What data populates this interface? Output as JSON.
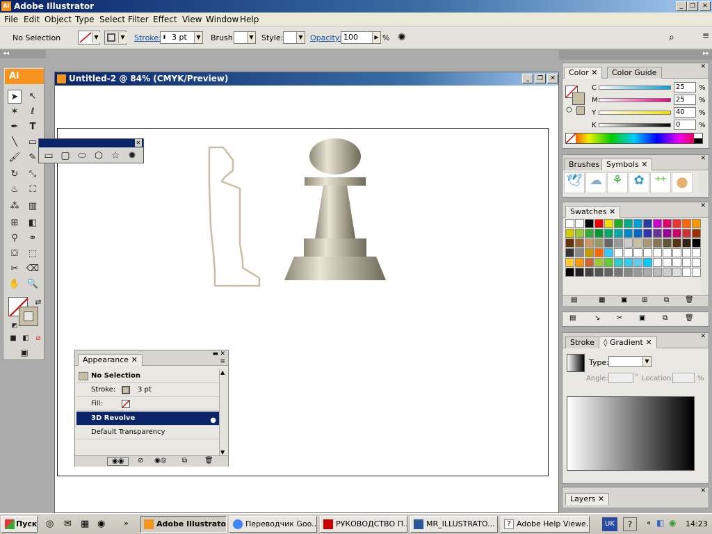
{
  "app": {
    "title": "Adobe Illustrator"
  },
  "menu": [
    "File",
    "Edit",
    "Object",
    "Type",
    "Select",
    "Filter",
    "Effect",
    "View",
    "Window",
    "Help"
  ],
  "control": {
    "selection": "No Selection",
    "stroke_label": "Stroke:",
    "stroke_value": "3 pt",
    "brush_label": "Brush:",
    "style_label": "Style:",
    "opacity_label": "Opacity:",
    "opacity_value": "100",
    "percent": "%"
  },
  "document": {
    "title": "Untitled-2 @ 84% (CMYK/Preview)"
  },
  "tools_logo": "Ai",
  "appearance": {
    "tab": "Appearance",
    "header": "No Selection",
    "stroke_label": "Stroke:",
    "stroke_value": "3 pt",
    "fill_label": "Fill:",
    "effect": "3D Revolve",
    "transparency": "Default Transparency"
  },
  "color_panel": {
    "tabs": [
      "Color",
      "Color Guide"
    ],
    "channels": [
      {
        "name": "C",
        "value": "25"
      },
      {
        "name": "M",
        "value": "25"
      },
      {
        "name": "Y",
        "value": "40"
      },
      {
        "name": "K",
        "value": "0"
      }
    ],
    "pct": "%"
  },
  "brushes_panel": {
    "tabs": [
      "Brushes",
      "Symbols"
    ]
  },
  "swatches_panel": {
    "tab": "Swatches"
  },
  "gradient_panel": {
    "tabs": [
      "Stroke",
      "Gradient"
    ],
    "type_label": "Type:",
    "angle_label": "Angle:",
    "degree": "°",
    "location_label": "Location:",
    "pct": "%"
  },
  "layers_panel": {
    "tab": "Layers"
  },
  "taskbar": {
    "start": "Пуск",
    "buttons": [
      "Adobe Illustrator",
      "Переводчик Goo...",
      "РУКОВОДСТВО П...",
      "MR_ILLUSTRATO...",
      "Adobe Help Viewe..."
    ],
    "lang": "UK",
    "clock": "14:23"
  }
}
